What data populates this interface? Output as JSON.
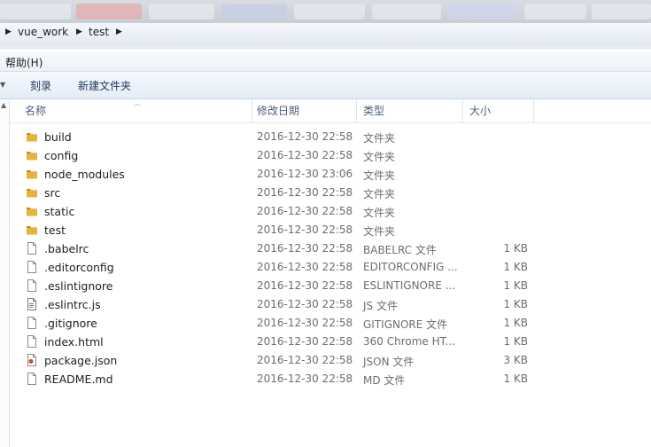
{
  "breadcrumb": {
    "items": [
      "vue_work",
      "test"
    ]
  },
  "menu": {
    "help": "帮助(H)"
  },
  "toolbar": {
    "burn": "刻录",
    "new_folder": "新建文件夹"
  },
  "columns": {
    "name": "名称",
    "date": "修改日期",
    "type": "类型",
    "size": "大小"
  },
  "files": [
    {
      "name": "build",
      "date": "2016-12-30 22:58",
      "type": "文件夹",
      "size": "",
      "icon": "folder-icon"
    },
    {
      "name": "config",
      "date": "2016-12-30 22:58",
      "type": "文件夹",
      "size": "",
      "icon": "folder-icon"
    },
    {
      "name": "node_modules",
      "date": "2016-12-30 23:06",
      "type": "文件夹",
      "size": "",
      "icon": "folder-icon"
    },
    {
      "name": "src",
      "date": "2016-12-30 22:58",
      "type": "文件夹",
      "size": "",
      "icon": "folder-icon"
    },
    {
      "name": "static",
      "date": "2016-12-30 22:58",
      "type": "文件夹",
      "size": "",
      "icon": "folder-icon"
    },
    {
      "name": "test",
      "date": "2016-12-30 22:58",
      "type": "文件夹",
      "size": "",
      "icon": "folder-icon"
    },
    {
      "name": ".babelrc",
      "date": "2016-12-30 22:58",
      "type": "BABELRC 文件",
      "size": "1 KB",
      "icon": "file-icon"
    },
    {
      "name": ".editorconfig",
      "date": "2016-12-30 22:58",
      "type": "EDITORCONFIG ...",
      "size": "1 KB",
      "icon": "file-icon"
    },
    {
      "name": ".eslintignore",
      "date": "2016-12-30 22:58",
      "type": "ESLINTIGNORE ...",
      "size": "1 KB",
      "icon": "file-icon"
    },
    {
      "name": ".eslintrc.js",
      "date": "2016-12-30 22:58",
      "type": "JS 文件",
      "size": "1 KB",
      "icon": "script-file-icon"
    },
    {
      "name": ".gitignore",
      "date": "2016-12-30 22:58",
      "type": "GITIGNORE 文件",
      "size": "1 KB",
      "icon": "file-icon"
    },
    {
      "name": "index.html",
      "date": "2016-12-30 22:58",
      "type": "360 Chrome HT...",
      "size": "1 KB",
      "icon": "file-icon"
    },
    {
      "name": "package.json",
      "date": "2016-12-30 22:58",
      "type": "JSON 文件",
      "size": "3 KB",
      "icon": "json-file-icon"
    },
    {
      "name": "README.md",
      "date": "2016-12-30 22:58",
      "type": "MD 文件",
      "size": "1 KB",
      "icon": "file-icon"
    }
  ],
  "colors": {
    "folder": "#e8b23c",
    "folder_dark": "#c98d16",
    "header_text": "#4c607a",
    "toolbar_text": "#1e395b"
  }
}
